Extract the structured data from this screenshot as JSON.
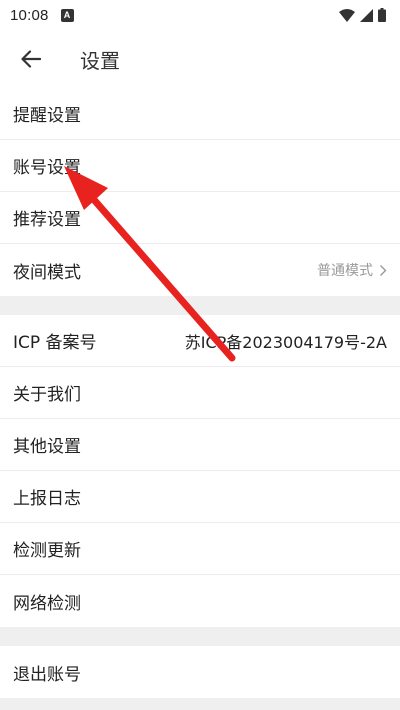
{
  "status_bar": {
    "time": "10:08",
    "badge": "A"
  },
  "header": {
    "title": "设置",
    "back_icon": "arrow-left-icon"
  },
  "settings_group_1": [
    {
      "label": "提醒设置"
    },
    {
      "label": "账号设置"
    },
    {
      "label": "推荐设置"
    },
    {
      "label": "夜间模式",
      "value": "普通模式"
    }
  ],
  "settings_group_2": [
    {
      "label": "ICP 备案号",
      "value": "苏ICP备2023004179号-2A"
    },
    {
      "label": "关于我们"
    },
    {
      "label": "其他设置"
    },
    {
      "label": "上报日志"
    },
    {
      "label": "检测更新"
    },
    {
      "label": "网络检测"
    }
  ],
  "settings_group_3": [
    {
      "label": "退出账号"
    }
  ],
  "annotation": {
    "arrow_color": "#e8231f"
  }
}
